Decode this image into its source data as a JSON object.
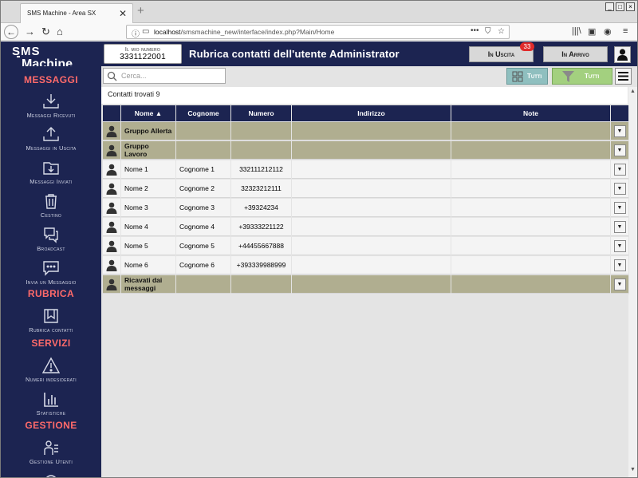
{
  "browser": {
    "tab_title": "SMS Machine - Area SX",
    "tab_close": "✕",
    "new_tab": "+",
    "url_host": "localhost",
    "url_path": "/smsmachine_new/interface/index.php?Main/Home"
  },
  "header": {
    "my_number_label": "Il mio numero",
    "my_number_value": "3331122001",
    "title": "Rubrica contatti dell'utente Administrator",
    "outgoing_label": "In Uscita",
    "outgoing_badge": "33",
    "incoming_label": "In Arrivo",
    "logo_text_top": "SMS",
    "logo_text_bottom": "Machine"
  },
  "sidebar": {
    "sections": {
      "messaggi": "MESSAGGI",
      "rubrica": "RUBRICA",
      "servizi": "SERVIZI",
      "gestione": "GESTIONE"
    },
    "items": [
      {
        "label": "Messaggi Ricevuti",
        "icon": "inbox-download-icon"
      },
      {
        "label": "Messaggi in Uscita",
        "icon": "outbox-upload-icon"
      },
      {
        "label": "Messaggi Inviati",
        "icon": "sent-folder-icon"
      },
      {
        "label": "Cestino",
        "icon": "trash-icon"
      },
      {
        "label": "Broadcast",
        "icon": "broadcast-icon"
      },
      {
        "label": "Invia un Messaggio",
        "icon": "chat-icon"
      },
      {
        "label": "Rubrica contatti",
        "icon": "address-book-icon"
      },
      {
        "label": "Numeri indesiderati",
        "icon": "warning-icon"
      },
      {
        "label": "Statistiche",
        "icon": "bar-chart-icon"
      },
      {
        "label": "Gestione Utenti",
        "icon": "users-icon"
      }
    ]
  },
  "toolbar": {
    "search_placeholder": "Cerca...",
    "all_label": "Tutti",
    "filter_label": "Tutti"
  },
  "contacts_found": "Contatti trovati 9",
  "table": {
    "headers": [
      "Nome ▲",
      "Cognome",
      "Numero",
      "Indirizzo",
      "Note"
    ],
    "rows": [
      {
        "group": true,
        "nome": "Gruppo Allerta",
        "cognome": "",
        "numero": "",
        "indirizzo": "",
        "note": ""
      },
      {
        "group": true,
        "nome": "Gruppo Lavoro",
        "cognome": "",
        "numero": "",
        "indirizzo": "",
        "note": ""
      },
      {
        "group": false,
        "nome": "Nome 1",
        "cognome": "Cognome 1",
        "numero": "332111212112",
        "indirizzo": "",
        "note": ""
      },
      {
        "group": false,
        "nome": "Nome 2",
        "cognome": "Cognome 2",
        "numero": "32323212111",
        "indirizzo": "",
        "note": ""
      },
      {
        "group": false,
        "nome": "Nome 3",
        "cognome": "Cognome 3",
        "numero": "+39324234",
        "indirizzo": "",
        "note": ""
      },
      {
        "group": false,
        "nome": "Nome 4",
        "cognome": "Cognome 4",
        "numero": "+39333221122",
        "indirizzo": "",
        "note": ""
      },
      {
        "group": false,
        "nome": "Nome 5",
        "cognome": "Cognome 5",
        "numero": "+44455667888",
        "indirizzo": "",
        "note": ""
      },
      {
        "group": false,
        "nome": "Nome 6",
        "cognome": "Cognome 6",
        "numero": "+393339988999",
        "indirizzo": "",
        "note": ""
      },
      {
        "group": true,
        "nome": "Ricavati dai messaggi",
        "cognome": "",
        "numero": "",
        "indirizzo": "",
        "note": ""
      }
    ]
  },
  "colors": {
    "navy": "#1c2451",
    "section_red": "#ff6a6a",
    "group_row": "#b0ae90",
    "badge": "#e02b2b"
  }
}
